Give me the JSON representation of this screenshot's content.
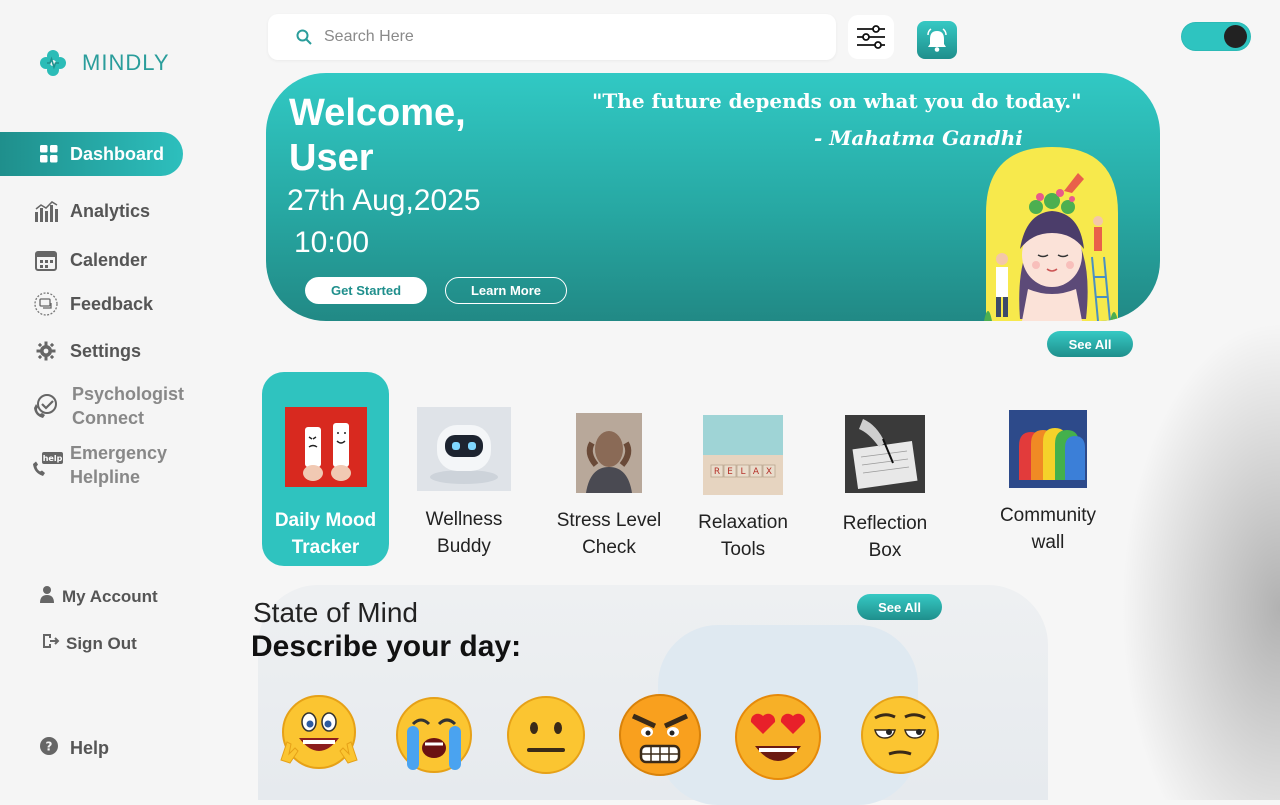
{
  "brand": {
    "name": "MINDLY",
    "accent": "#2a9d9b"
  },
  "sidebar": {
    "items": [
      {
        "id": "dashboard",
        "label": "Dashboard",
        "icon": "dashboard-grid-icon",
        "active": true
      },
      {
        "id": "analytics",
        "label": "Analytics",
        "icon": "bar-chart-icon"
      },
      {
        "id": "calendar",
        "label": "Calender",
        "icon": "calendar-icon"
      },
      {
        "id": "feedback",
        "label": "Feedback",
        "icon": "feedback-icon"
      },
      {
        "id": "settings",
        "label": "Settings",
        "icon": "gear-icon"
      },
      {
        "id": "psychologist",
        "label_line1": "Psychologist",
        "label_line2": "Connect",
        "icon": "phone-check-icon"
      },
      {
        "id": "emergency",
        "label_line1": "Emergency",
        "label_line2": "Helpline",
        "icon": "help-phone-icon"
      }
    ],
    "account": {
      "label": "My Account",
      "icon": "user-icon"
    },
    "signout": {
      "label": "Sign Out",
      "icon": "sign-out-icon"
    },
    "help": {
      "label": "Help",
      "icon": "question-icon"
    }
  },
  "topbar": {
    "search_placeholder": "Search Here",
    "filter_icon": "sliders-icon",
    "bell_icon": "bell-icon",
    "toggle_on": true
  },
  "hero": {
    "welcome_line1": "Welcome,",
    "welcome_line2": "User",
    "date": "27th Aug,2025",
    "time": "10:00",
    "get_started": "Get Started",
    "learn_more": "Learn More",
    "quote": "\"The future depends on what you do today.\"",
    "author": "- Mahatma Gandhi"
  },
  "features": {
    "see_all": "See All",
    "cards": [
      {
        "line1": "Daily Mood",
        "line2": "Tracker",
        "image": "mood-tracker-image",
        "active": true
      },
      {
        "line1": "Wellness",
        "line2": "Buddy",
        "image": "robot-chat-image"
      },
      {
        "line1": "Stress Level",
        "line2": "Check",
        "image": "stress-person-image"
      },
      {
        "line1": "Relaxation",
        "line2": "Tools",
        "image": "relax-blocks-image"
      },
      {
        "line1": "Reflection",
        "line2": "Box",
        "image": "journal-writing-image"
      },
      {
        "line1": "Community",
        "line2": "wall",
        "image": "rainbow-heads-image"
      }
    ]
  },
  "mind": {
    "title": "State of Mind",
    "subtitle": "Describe your day:",
    "see_all": "See All",
    "moods": [
      "happy-emoji",
      "crying-emoji",
      "neutral-emoji",
      "angry-emoji",
      "heart-eyes-emoji",
      "unamused-emoji"
    ]
  }
}
